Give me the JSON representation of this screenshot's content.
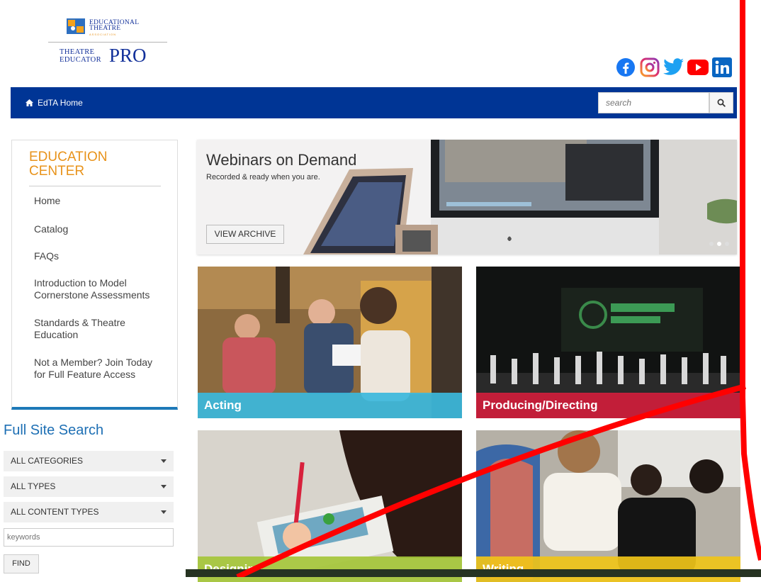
{
  "header": {
    "org_line1": "EDUCATIONAL",
    "org_line2": "THEATRE",
    "org_line3": "ASSOCIATION",
    "brand_small1": "THEATRE",
    "brand_small2": "EDUCATOR",
    "brand_big": "PRO",
    "social": [
      "facebook-icon",
      "instagram-icon",
      "twitter-icon",
      "youtube-icon",
      "linkedin-icon"
    ]
  },
  "nav": {
    "home_label": "EdTA Home",
    "search_placeholder": "search"
  },
  "sidebar": {
    "title": "EDUCATION CENTER",
    "items": [
      {
        "label": "Home"
      },
      {
        "label": "Catalog"
      },
      {
        "label": "FAQs"
      },
      {
        "label": "Introduction to Model Cornerstone Assessments"
      },
      {
        "label": "Standards & Theatre Education"
      },
      {
        "label": "Not a Member? Join Today for Full Feature Access"
      }
    ]
  },
  "site_search": {
    "title": "Full Site Search",
    "categories": "ALL CATEGORIES",
    "types": "ALL TYPES",
    "content_types": "ALL CONTENT TYPES",
    "keywords_placeholder": "keywords",
    "find_label": "FIND"
  },
  "banner": {
    "title": "Webinars on Demand",
    "subtitle": "Recorded & ready when you are.",
    "button": "VIEW ARCHIVE",
    "slides_count": 3,
    "active_slide": 2
  },
  "tiles": [
    {
      "label": "Acting",
      "color": "#3bb8dc"
    },
    {
      "label": "Producing/Directing",
      "color": "#cc1f3c"
    },
    {
      "label": "Designing",
      "color": "#a5c63a"
    },
    {
      "label": "Writing",
      "color": "#f0c419"
    }
  ],
  "colors": {
    "nav": "#003595",
    "accent_orange": "#e8931b",
    "link_blue": "#1d6fb4",
    "annotation_red": "#ff0000"
  }
}
